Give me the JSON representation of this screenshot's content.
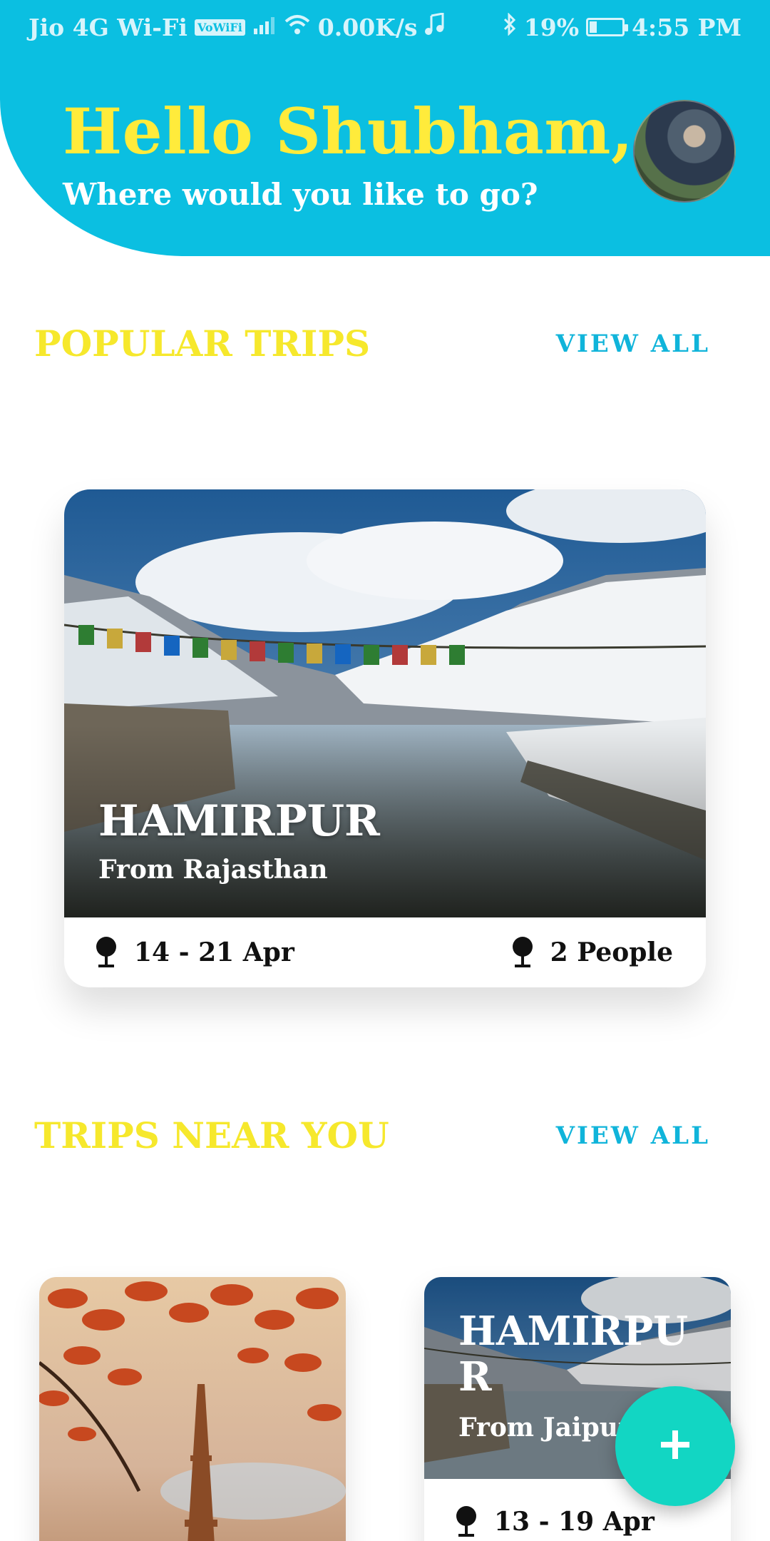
{
  "status_bar": {
    "carrier": "Jio 4G Wi-Fi",
    "vowifi": "VoWiFi",
    "speed": "0.00K/s",
    "battery": "19%",
    "time": "4:55 PM"
  },
  "header": {
    "greeting": "Hello Shubham,",
    "subtitle": "Where would you like to go?",
    "background_color": "#0bbfe1",
    "greeting_color": "#ffeb3b"
  },
  "popular": {
    "title": "POPULAR TRIPS",
    "view_all": "VIEW ALL",
    "card": {
      "place": "HAMIRPUR",
      "from": "From Rajasthan",
      "dates": "14 - 21 Apr",
      "people": "2 People"
    }
  },
  "nearby": {
    "title": "TRIPS NEAR YOU",
    "view_all": "VIEW ALL",
    "cards": [
      {
        "image": "eiffel-tower-autumn"
      },
      {
        "place": "HAMIRPUR",
        "from": "From Jaipur",
        "dates": "13 - 19 Apr"
      }
    ]
  },
  "fab": {
    "icon": "plus-icon",
    "color": "#12d6c3"
  }
}
